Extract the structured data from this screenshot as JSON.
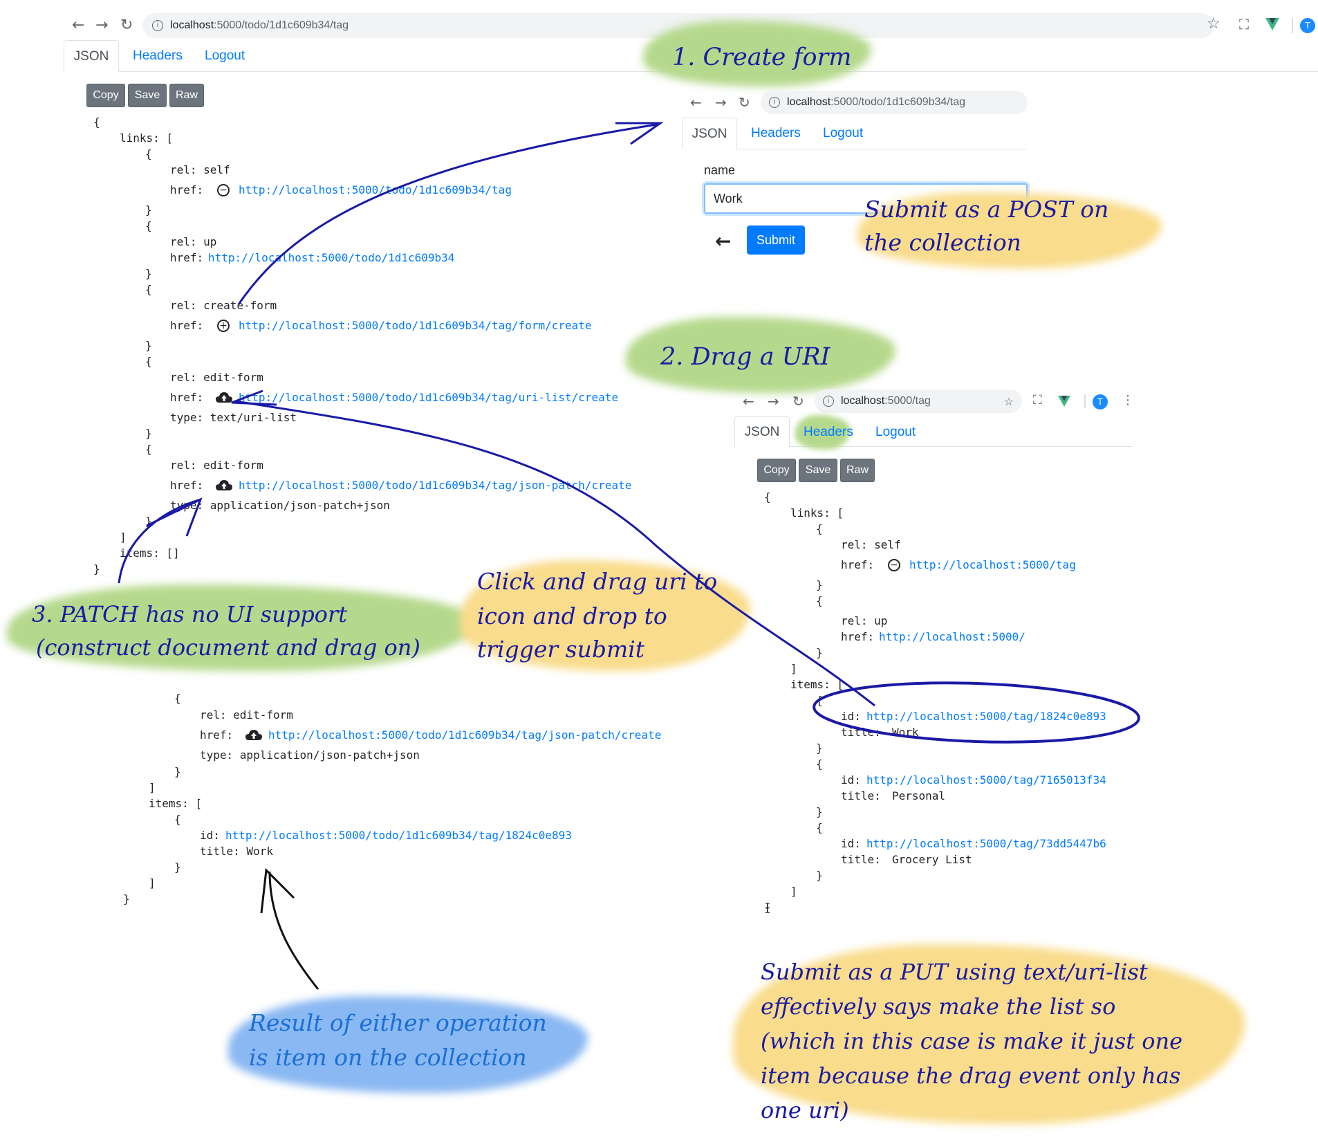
{
  "main_browser": {
    "url_host": "localhost",
    "url_path": ":5000/todo/1d1c609b34/tag",
    "tabs": [
      "JSON",
      "Headers",
      "Logout"
    ],
    "buttons": [
      "Copy",
      "Save",
      "Raw"
    ],
    "avatar": "T",
    "json": {
      "open": "{",
      "links_key": "links: [",
      "self_rel": "rel: self",
      "href_label": "href:",
      "self_href": "http://localhost:5000/todo/1d1c609b34/tag",
      "up_rel": "rel: up",
      "up_href": "http://localhost:5000/todo/1d1c609b34",
      "create_rel": "rel: create-form",
      "create_href": "http://localhost:5000/todo/1d1c609b34/tag/form/create",
      "edit_rel": "rel: edit-form",
      "edit1_href": "http://localhost:5000/todo/1d1c609b34/tag/uri-list/create",
      "edit1_type": "type: text/uri-list",
      "edit2_href": "http://localhost:5000/todo/1d1c609b34/tag/json-patch/create",
      "edit2_type": "type: application/json-patch+json",
      "items_empty": "items: []",
      "brace_open": "{",
      "brace_close": "}",
      "bracket_close": "]",
      "close": "}"
    }
  },
  "form_browser": {
    "url_host": "localhost",
    "url_path": ":5000/todo/1d1c609b34/tag",
    "tabs": [
      "JSON",
      "Headers",
      "Logout"
    ],
    "field_label": "name",
    "field_value": "Work",
    "submit_label": "Submit",
    "back_arrow": "←"
  },
  "tag_browser": {
    "url_host": "localhost",
    "url_path": ":5000/tag",
    "tabs": [
      "JSON",
      "Headers",
      "Logout"
    ],
    "buttons": [
      "Copy",
      "Save",
      "Raw"
    ],
    "avatar": "T",
    "json": {
      "open": "{",
      "links_key": "links: [",
      "self_rel": "rel: self",
      "href_label": "href:",
      "self_href": "http://localhost:5000/tag",
      "up_rel": "rel: up",
      "up_href": "http://localhost:5000/",
      "items_key": "items: [",
      "id_label": "id:",
      "title_label": "title:",
      "items": [
        {
          "id": "http://localhost:5000/tag/1824c0e893",
          "title": "Work"
        },
        {
          "id": "http://localhost:5000/tag/7165013f34",
          "title": "Personal"
        },
        {
          "id": "http://localhost:5000/tag/73dd5447b6",
          "title": "Grocery List"
        }
      ]
    }
  },
  "result_json": {
    "edit_rel": "rel: edit-form",
    "href_label": "href:",
    "edit_href": "http://localhost:5000/todo/1d1c609b34/tag/json-patch/create",
    "edit_type": "type: application/json-patch+json",
    "items_key": "items: [",
    "id_label": "id:",
    "id_href": "http://localhost:5000/todo/1d1c609b34/tag/1824c0e893",
    "title": "title: Work"
  },
  "annotations": {
    "step1": "1. Create form",
    "step2": "2. Drag a URI",
    "step3_line1": "3. PATCH has no UI support",
    "step3_line2": "(construct document and drag on)",
    "post_note_line1": "Submit as a POST on",
    "post_note_line2": "the collection",
    "drag_note_line1": "Click and drag uri to",
    "drag_note_line2": "icon and drop to",
    "drag_note_line3": "trigger submit",
    "result_note_line1": "Result of either operation",
    "result_note_line2": "is item on the collection",
    "put_note_line1": "Submit as a PUT using text/uri-list",
    "put_note_line2": "effectively says make the list so",
    "put_note_line3": "(which in this case is make it just one",
    "put_note_line4": "item because the drag event only has",
    "put_note_line5": "one uri)"
  },
  "colors": {
    "link": "#007bff",
    "annotation_ink": "#1a1aa6",
    "highlight_green": "#b5d98c",
    "highlight_yellow": "#f9dc8c",
    "highlight_blue": "#8ab8f2"
  }
}
